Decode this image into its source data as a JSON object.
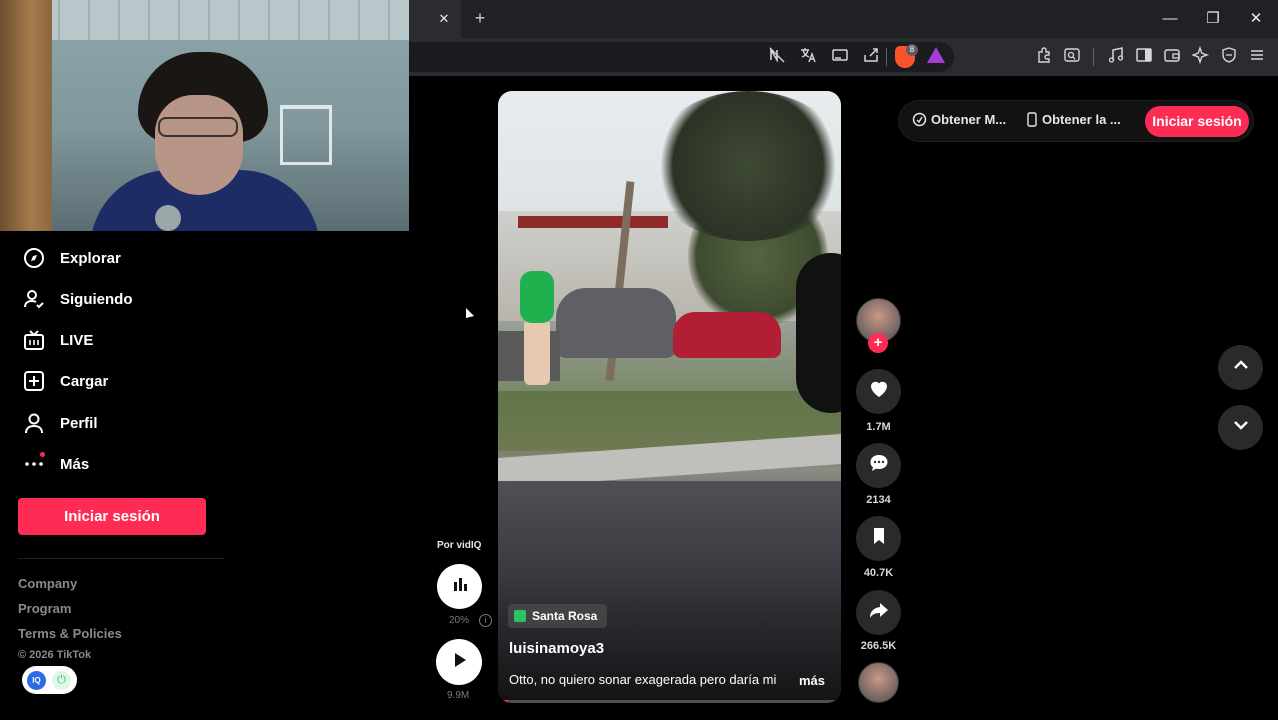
{
  "browser": {
    "tab_close": "✕",
    "new_tab": "+",
    "window_controls": {
      "minimize": "—",
      "restore": "❐",
      "close": "✕"
    },
    "toolbar_icons": [
      "reader-off-icon",
      "translate-icon",
      "cast-icon",
      "share-icon",
      "brave-shields-icon",
      "brave-rewards-icon",
      "extensions-icon",
      "screenshot-icon",
      "media-icon",
      "sidebar-icon",
      "wallet-icon",
      "leo-ai-icon",
      "vpn-icon",
      "menu-icon"
    ],
    "shields_badge": "8"
  },
  "sidebar": {
    "items": [
      {
        "label": "Explorar",
        "icon": "compass-icon"
      },
      {
        "label": "Siguiendo",
        "icon": "user-follow-icon"
      },
      {
        "label": "LIVE",
        "icon": "live-tv-icon"
      },
      {
        "label": "Cargar",
        "icon": "upload-plus-icon"
      },
      {
        "label": "Perfil",
        "icon": "user-icon"
      },
      {
        "label": "Más",
        "icon": "more-dots-icon"
      }
    ],
    "login_label": "Iniciar sesión",
    "footer": {
      "company": "Company",
      "program": "Program",
      "terms": "Terms & Policies",
      "copyright": "© 2026 TikTok"
    },
    "extension_badge": "IQ"
  },
  "video": {
    "location": "Santa Rosa",
    "username": "luisinamoya3",
    "caption": "Otto, no quiero sonar exagerada pero daría mi",
    "more_label": "más",
    "progress": 0.03
  },
  "vidiq": {
    "label": "Por vidIQ",
    "percent": "20%",
    "views": "9.9M",
    "info": "i"
  },
  "actions": {
    "likes": "1.7M",
    "comments": "2134",
    "saves": "40.7K",
    "shares": "266.5K",
    "follow": "+"
  },
  "top_bar": {
    "get_app_1": "Obtener M...",
    "get_app_2": "Obtener la ...",
    "login": "Iniciar sesión"
  },
  "colors": {
    "accent": "#fe2c55",
    "background": "#000000",
    "chrome": "#202124"
  }
}
